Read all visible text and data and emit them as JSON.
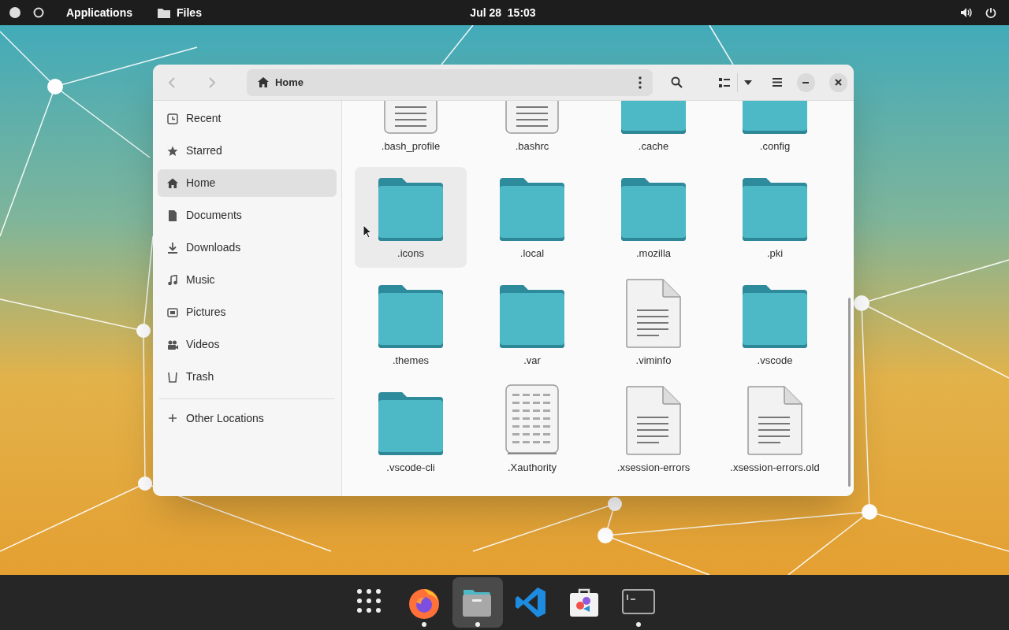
{
  "top_bar": {
    "activities": "Applications",
    "app_menu": "Files",
    "clock": "Jul 28  15:03"
  },
  "window": {
    "path": "Home"
  },
  "sidebar": {
    "items": [
      {
        "label": "Recent",
        "selected": false
      },
      {
        "label": "Starred",
        "selected": false
      },
      {
        "label": "Home",
        "selected": true
      },
      {
        "label": "Documents",
        "selected": false
      },
      {
        "label": "Downloads",
        "selected": false
      },
      {
        "label": "Music",
        "selected": false
      },
      {
        "label": "Pictures",
        "selected": false
      },
      {
        "label": "Videos",
        "selected": false
      },
      {
        "label": "Trash",
        "selected": false
      }
    ],
    "other": {
      "label": "Other Locations"
    }
  },
  "files": [
    {
      "name": ".bash_profile",
      "kind": "script",
      "hovered": false
    },
    {
      "name": ".bashrc",
      "kind": "script",
      "hovered": false
    },
    {
      "name": ".cache",
      "kind": "folder",
      "hovered": false
    },
    {
      "name": ".config",
      "kind": "folder",
      "hovered": false
    },
    {
      "name": ".icons",
      "kind": "folder",
      "hovered": true
    },
    {
      "name": ".local",
      "kind": "folder",
      "hovered": false
    },
    {
      "name": ".mozilla",
      "kind": "folder",
      "hovered": false
    },
    {
      "name": ".pki",
      "kind": "folder",
      "hovered": false
    },
    {
      "name": ".themes",
      "kind": "folder",
      "hovered": false
    },
    {
      "name": ".var",
      "kind": "folder",
      "hovered": false
    },
    {
      "name": ".viminfo",
      "kind": "document",
      "hovered": false
    },
    {
      "name": ".vscode",
      "kind": "folder",
      "hovered": false
    },
    {
      "name": ".vscode-cli",
      "kind": "folder",
      "hovered": false
    },
    {
      "name": ".Xauthority",
      "kind": "binary",
      "hovered": false
    },
    {
      "name": ".xsession-errors",
      "kind": "document",
      "hovered": false
    },
    {
      "name": ".xsession-errors.old",
      "kind": "document",
      "hovered": false
    }
  ],
  "dock": [
    {
      "running": false,
      "selected": false
    },
    {
      "running": true,
      "selected": false
    },
    {
      "running": true,
      "selected": true
    },
    {
      "running": false,
      "selected": false
    },
    {
      "running": false,
      "selected": false
    },
    {
      "running": true,
      "selected": false
    }
  ]
}
